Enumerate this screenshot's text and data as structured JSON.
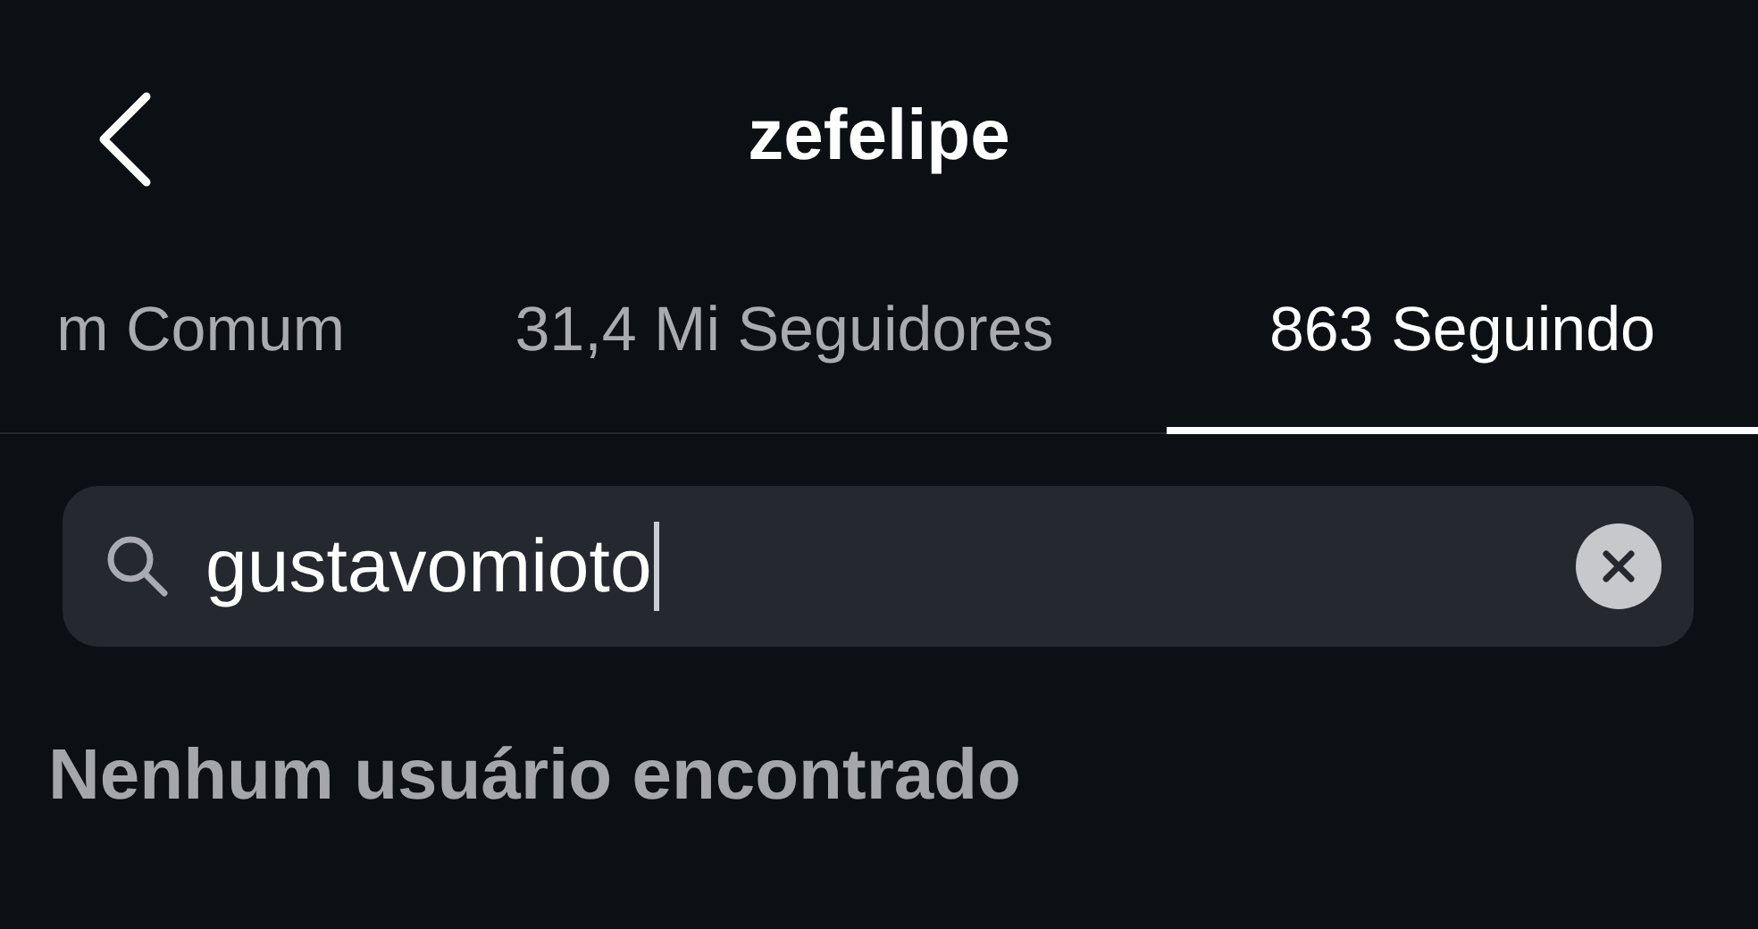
{
  "header": {
    "title": "zefelipe"
  },
  "tabs": [
    {
      "label": "m Comum",
      "selected": false
    },
    {
      "label": "31,4 Mi Seguidores",
      "selected": false
    },
    {
      "label": "863 Seguindo",
      "selected": true
    }
  ],
  "search": {
    "value": "gustavomioto",
    "focused": true
  },
  "empty_message": "Nenhum usuário encontrado"
}
